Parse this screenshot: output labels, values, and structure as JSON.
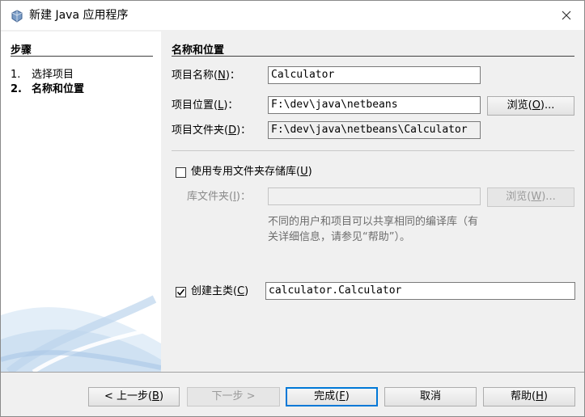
{
  "window": {
    "title": "新建 Java 应用程序",
    "title_icon": "java-cup-icon",
    "close_icon": "close-icon"
  },
  "steps": {
    "title": "步骤",
    "items": [
      {
        "num": "1.",
        "label": "选择项目",
        "active": false
      },
      {
        "num": "2.",
        "label": "名称和位置",
        "active": true
      }
    ]
  },
  "form": {
    "section_title": "名称和位置",
    "project_name": {
      "label_pre": "项目名称(",
      "mnemonic": "N",
      "label_post": ")：",
      "value": "Calculator"
    },
    "project_location": {
      "label_pre": "项目位置(",
      "mnemonic": "L",
      "label_post": ")：",
      "value": "F:\\dev\\java\\netbeans",
      "browse_pre": "浏览(",
      "browse_mnemonic": "O",
      "browse_post": ")..."
    },
    "project_folder": {
      "label_pre": "项目文件夹(",
      "mnemonic": "D",
      "label_post": ")：",
      "value": "F:\\dev\\java\\netbeans\\Calculator"
    },
    "shared_libs": {
      "label_pre": "使用专用文件夹存储库(",
      "mnemonic": "U",
      "label_post": ")",
      "checked": false,
      "folder_label_pre": "库文件夹(",
      "folder_mnemonic": "I",
      "folder_label_post": ")：",
      "folder_value": "",
      "browse_pre": "浏览(",
      "browse_mnemonic": "W",
      "browse_post": ")...",
      "help_text": "不同的用户和项目可以共享相同的编译库（有关详细信息，请参见“帮助”）。"
    },
    "main_class": {
      "label_pre": "创建主类(",
      "mnemonic": "C",
      "label_post": ")",
      "checked": true,
      "value": "calculator.Calculator"
    }
  },
  "buttons": {
    "back": {
      "pre": "< 上一步(",
      "mnemonic": "B",
      "post": ")"
    },
    "next": {
      "pre": "下一步 >",
      "mnemonic": "",
      "post": ""
    },
    "finish": {
      "pre": "完成(",
      "mnemonic": "F",
      "post": ")"
    },
    "cancel": {
      "pre": "取消",
      "mnemonic": "",
      "post": ""
    },
    "help": {
      "pre": "帮助(",
      "mnemonic": "H",
      "post": ")"
    }
  },
  "colors": {
    "accent": "#0078d7",
    "disabled_text": "#8a8a8a"
  }
}
